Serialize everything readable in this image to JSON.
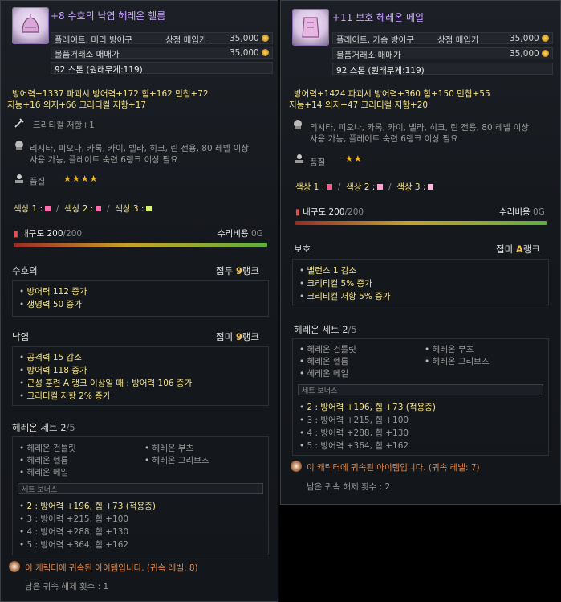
{
  "tooltip_a": {
    "title": "+8 수호의 낙엽 헤레온 헬름",
    "type_label": "플레이트, 머리 방어구",
    "sell_label": "상점 매입가",
    "sell_price": "35,000",
    "trade_label": "물품거래소 매매가",
    "trade_price": "35,000",
    "weight": "92 스톤 (원래무게:119)",
    "stats_line1": "방어력+1337   파괴시 방어력+172   힘+162   민첩+72",
    "stats_line2": "지능+16   의지+66   크리티컬 저항+17",
    "engrave": "크리티컬 저항+1",
    "req_line1": "리시타, 피오나, 카록, 카이, 벨라, 히크, 린 전용, 80 레벨 이상",
    "req_line2": "사용 가능, 플레이트 숙련 6랭크 이상 필요",
    "quality_label": "품질",
    "quality_stars": "★★★★",
    "color_labels": [
      "색상 1 :",
      "색상 2 :",
      "색상 3 :"
    ],
    "durability_label": "내구도",
    "durability_value": "200/200",
    "durability_current": "200",
    "durability_max": "/200",
    "repair_label": "수리비용",
    "repair_value": "0G",
    "sec1_title": "수호의",
    "sec1_rank_prefix": "접두 ",
    "sec1_rank_num": "9",
    "sec1_rank_suffix": "랭크",
    "sec1_items": [
      "방어력 112 증가",
      "생명력 50 증가"
    ],
    "sec2_title": "낙엽",
    "sec2_rank_prefix": "접미 ",
    "sec2_rank_num": "9",
    "sec2_rank_suffix": "랭크",
    "sec2_items": [
      "공격력 15 감소",
      "방어력 118 증가",
      "근성 훈련 A 랭크 이상일 때 : 방어력 106 증가",
      "크리티컬 저항 2% 증가"
    ],
    "set_title": "헤레온 세트 2",
    "set_count": "/5",
    "set_parts": [
      "헤레온 건틀릿",
      "헤레온 부츠",
      "헤레온 헬름",
      "헤레온 그리브즈",
      "헤레온 메일"
    ],
    "set_bonus_label": "세트 보너스",
    "set_bonuses": [
      "2 : 방어력 +196, 힘 +73 (적용중)",
      "3 : 방어력 +215, 힘 +100",
      "4 : 방어력 +288, 힘 +130",
      "5 : 방어력 +364, 힘 +162"
    ],
    "bound_text": "이 캐릭터에 귀속된 아이템입니다. (귀속 레벨: 8)",
    "unbind_text": "남은 귀속 해제 횟수 : 1"
  },
  "tooltip_b": {
    "title": "+11 보호 헤레온 메일",
    "type_label": "플레이트, 가슴 방어구",
    "sell_label": "상점 매입가",
    "sell_price": "35,000",
    "trade_label": "물품거래소 매매가",
    "trade_price": "35,000",
    "weight": "92 스톤 (원래무게:119)",
    "stats_line1": "방어력+1424   파괴시 방어력+360   힘+150   민첩+55",
    "stats_line2": "지능+14   의지+47   크리티컬 저항+20",
    "req_line1": "리시타, 피오나, 카록, 카이, 벨라, 히크, 린 전용, 80 레벨 이상",
    "req_line2": "사용 가능, 플레이트 숙련 6랭크 이상 필요",
    "quality_label": "품질",
    "quality_stars": "★★",
    "color_labels": [
      "색상 1 :",
      "색상 2 :",
      "색상 3 :"
    ],
    "durability_label": "내구도",
    "durability_current": "200",
    "durability_max": "/200",
    "repair_label": "수리비용",
    "repair_value": "0G",
    "sec1_title": "보호",
    "sec1_rank_prefix": "접미 ",
    "sec1_rank_num": "A",
    "sec1_rank_suffix": "랭크",
    "sec1_items": [
      "밸런스 1 감소",
      "크리티컬 5% 증가",
      "크리티컬 저항 5% 증가"
    ],
    "set_title": "헤레온 세트 2",
    "set_count": "/5",
    "set_parts": [
      "헤레온 건틀릿",
      "헤레온 부츠",
      "헤레온 헬름",
      "헤레온 그리브즈",
      "헤레온 메일"
    ],
    "set_bonus_label": "세트 보너스",
    "set_bonuses": [
      "2 : 방어력 +196, 힘 +73 (적용중)",
      "3 : 방어력 +215, 힘 +100",
      "4 : 방어력 +288, 힘 +130",
      "5 : 방어력 +364, 힘 +162"
    ],
    "bound_text": "이 캐릭터에 귀속된 아이템입니다. (귀속 레벨: 7)",
    "unbind_text": "남은 귀속 해제 횟수 : 2"
  },
  "colors": {
    "title": "#c9a6ff",
    "rank_accent": "#f3c24a",
    "bound_text": "#e58a4a",
    "color_swatch_a": [
      "#ff6fb0",
      "#ff6fb0",
      "#d8f07a"
    ],
    "color_swatch_b": [
      "#ff5c8a",
      "#ff9fcf",
      "#ffb8d8"
    ]
  }
}
